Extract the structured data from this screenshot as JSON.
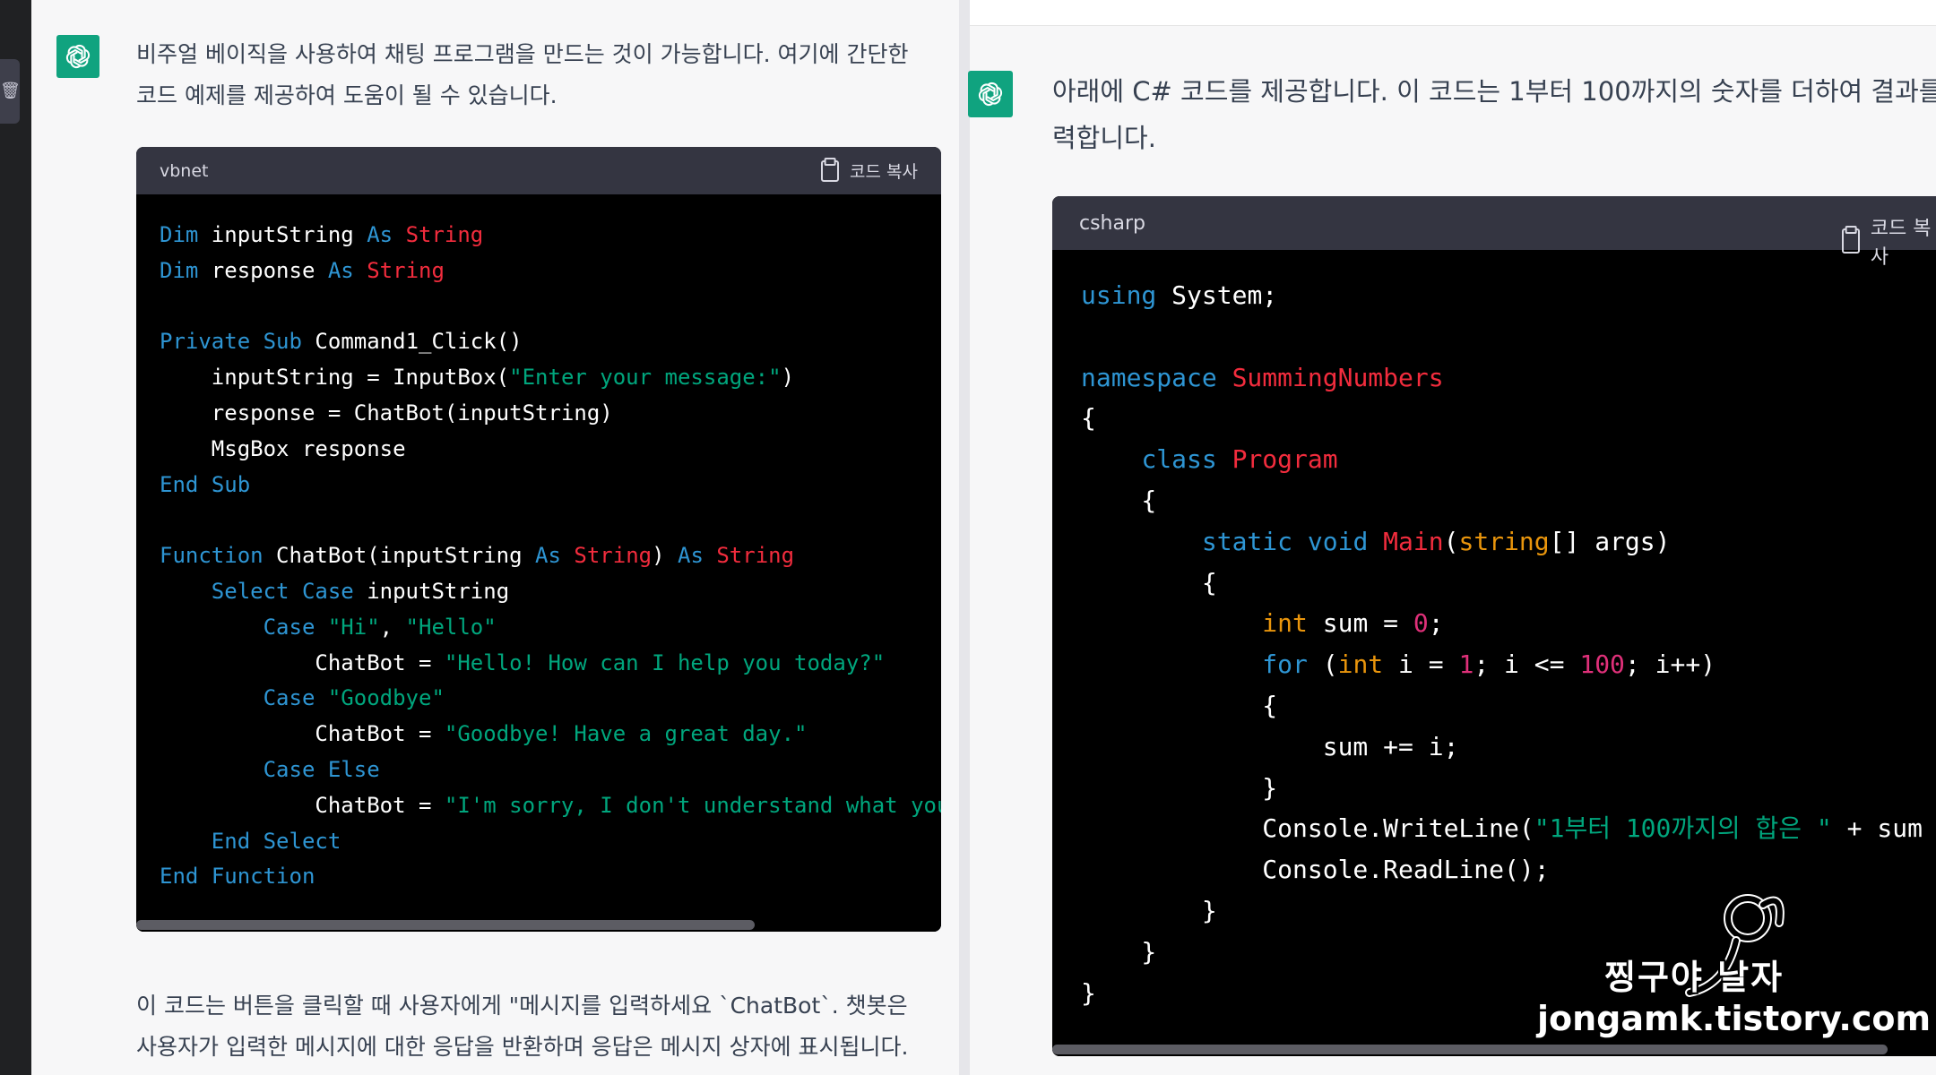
{
  "left": {
    "intro_line1": "비주얼 베이직을 사용하여 채팅 프로그램을 만드는 것이 가능합니다. 여기에 간단한",
    "intro_line2": "코드 예제를 제공하여 도움이 될 수 있습니다.",
    "code_lang": "vbnet",
    "copy_label": "코드 복사",
    "code": [
      [
        [
          "kw",
          "Dim"
        ],
        [
          "p",
          " inputString "
        ],
        [
          "kw",
          "As"
        ],
        [
          "p",
          " "
        ],
        [
          "ty",
          "String"
        ]
      ],
      [
        [
          "kw",
          "Dim"
        ],
        [
          "p",
          " response "
        ],
        [
          "kw",
          "As"
        ],
        [
          "p",
          " "
        ],
        [
          "ty",
          "String"
        ]
      ],
      [],
      [
        [
          "kw",
          "Private"
        ],
        [
          "p",
          " "
        ],
        [
          "kw",
          "Sub"
        ],
        [
          "p",
          " Command1_Click()"
        ]
      ],
      [
        [
          "p",
          "    inputString = InputBox("
        ],
        [
          "st",
          "\"Enter your message:\""
        ],
        [
          "p",
          ")"
        ]
      ],
      [
        [
          "p",
          "    response = ChatBot(inputString)"
        ]
      ],
      [
        [
          "p",
          "    MsgBox response"
        ]
      ],
      [
        [
          "kw",
          "End"
        ],
        [
          "p",
          " "
        ],
        [
          "kw",
          "Sub"
        ]
      ],
      [],
      [
        [
          "kw",
          "Function"
        ],
        [
          "p",
          " ChatBot(inputString "
        ],
        [
          "kw",
          "As"
        ],
        [
          "p",
          " "
        ],
        [
          "ty",
          "String"
        ],
        [
          "p",
          ") "
        ],
        [
          "kw",
          "As"
        ],
        [
          "p",
          " "
        ],
        [
          "ty",
          "String"
        ]
      ],
      [
        [
          "p",
          "    "
        ],
        [
          "kw",
          "Select"
        ],
        [
          "p",
          " "
        ],
        [
          "kw",
          "Case"
        ],
        [
          "p",
          " inputString"
        ]
      ],
      [
        [
          "p",
          "        "
        ],
        [
          "kw",
          "Case"
        ],
        [
          "p",
          " "
        ],
        [
          "st",
          "\"Hi\""
        ],
        [
          "p",
          ", "
        ],
        [
          "st",
          "\"Hello\""
        ]
      ],
      [
        [
          "p",
          "            ChatBot = "
        ],
        [
          "st",
          "\"Hello! How can I help you today?\""
        ]
      ],
      [
        [
          "p",
          "        "
        ],
        [
          "kw",
          "Case"
        ],
        [
          "p",
          " "
        ],
        [
          "st",
          "\"Goodbye\""
        ]
      ],
      [
        [
          "p",
          "            ChatBot = "
        ],
        [
          "st",
          "\"Goodbye! Have a great day.\""
        ]
      ],
      [
        [
          "p",
          "        "
        ],
        [
          "kw",
          "Case"
        ],
        [
          "p",
          " "
        ],
        [
          "kw",
          "Else"
        ]
      ],
      [
        [
          "p",
          "            ChatBot = "
        ],
        [
          "st",
          "\"I'm sorry, I don't understand what you're saying.\""
        ]
      ],
      [
        [
          "p",
          "    "
        ],
        [
          "kw",
          "End"
        ],
        [
          "p",
          " "
        ],
        [
          "kw",
          "Select"
        ]
      ],
      [
        [
          "kw",
          "End"
        ],
        [
          "p",
          " "
        ],
        [
          "kw",
          "Function"
        ]
      ]
    ],
    "outro_line1": "이 코드는 버튼을 클릭할 때 사용자에게 \"메시지를 입력하세요 `ChatBot`. 챗봇은",
    "outro_line2": "사용자가 입력한 메시지에 대한 응답을 반환하며 응답은 메시지 상자에 표시됩니다."
  },
  "right": {
    "intro_line1": "아래에 C# 코드를 제공합니다. 이 코드는 1부터 100까지의 숫자를 더하여 결과를 출",
    "intro_line2": "력합니다.",
    "code_lang": "csharp",
    "copy_label": "코드 복사",
    "code": [
      [
        [
          "kw",
          "using"
        ],
        [
          "p",
          " System;"
        ]
      ],
      [],
      [
        [
          "kw",
          "namespace"
        ],
        [
          "p",
          " "
        ],
        [
          "ty",
          "SummingNumbers"
        ]
      ],
      [
        [
          "p",
          "{"
        ]
      ],
      [
        [
          "p",
          "    "
        ],
        [
          "kw",
          "class"
        ],
        [
          "p",
          " "
        ],
        [
          "ty",
          "Program"
        ]
      ],
      [
        [
          "p",
          "    {"
        ]
      ],
      [
        [
          "p",
          "        "
        ],
        [
          "kw",
          "static"
        ],
        [
          "p",
          " "
        ],
        [
          "kw",
          "void"
        ],
        [
          "p",
          " "
        ],
        [
          "ty",
          "Main"
        ],
        [
          "p",
          "("
        ],
        [
          "ti",
          "string"
        ],
        [
          "p",
          "[] args)"
        ]
      ],
      [
        [
          "p",
          "        {"
        ]
      ],
      [
        [
          "p",
          "            "
        ],
        [
          "ti",
          "int"
        ],
        [
          "p",
          " sum = "
        ],
        [
          "nm",
          "0"
        ],
        [
          "p",
          ";"
        ]
      ],
      [
        [
          "p",
          "            "
        ],
        [
          "kw",
          "for"
        ],
        [
          "p",
          " ("
        ],
        [
          "ti",
          "int"
        ],
        [
          "p",
          " i = "
        ],
        [
          "nm",
          "1"
        ],
        [
          "p",
          "; i <= "
        ],
        [
          "nm",
          "100"
        ],
        [
          "p",
          "; i++)"
        ]
      ],
      [
        [
          "p",
          "            {"
        ]
      ],
      [
        [
          "p",
          "                sum += i;"
        ]
      ],
      [
        [
          "p",
          "            }"
        ]
      ],
      [
        [
          "p",
          "            Console.WriteLine("
        ],
        [
          "st",
          "\"1부터 100까지의 합은 \""
        ],
        [
          "p",
          " + sum + "
        ],
        [
          "st",
          "\".\""
        ],
        [
          "p",
          ");"
        ]
      ],
      [
        [
          "p",
          "            Console.ReadLine();"
        ]
      ],
      [
        [
          "p",
          "        }"
        ]
      ],
      [
        [
          "p",
          "    }"
        ]
      ],
      [
        [
          "p",
          "}"
        ]
      ]
    ]
  },
  "watermark": {
    "name": "찡구야 날자",
    "url": "jongamk.tistory.com"
  },
  "colors": {
    "keyword": "#2e95d3",
    "type": "#f22c3d",
    "string": "#00a67d",
    "number": "#df3079",
    "builtin_type": "#e9950c",
    "avatar": "#10a37f"
  },
  "icons": {
    "avatar": "openai-logo-icon",
    "copy": "clipboard-icon"
  }
}
